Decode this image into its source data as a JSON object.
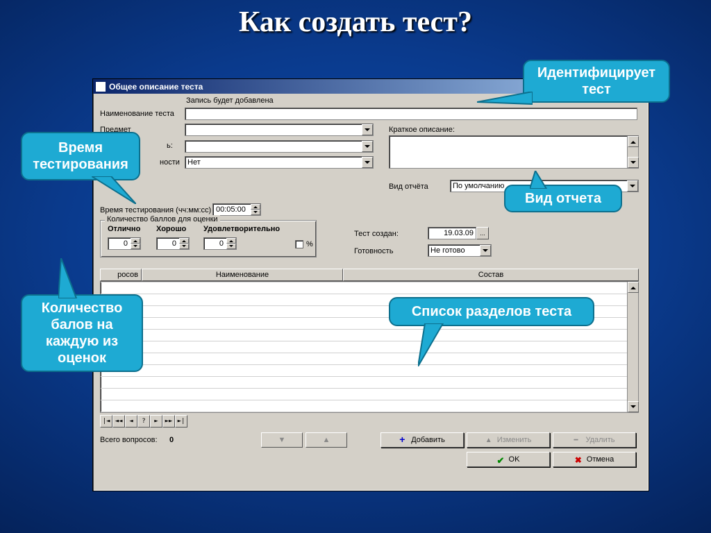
{
  "slide": {
    "title": "Как создать тест?"
  },
  "window": {
    "title": "Общее описание теста",
    "status_msg": "Запись будет добавлена",
    "labels": {
      "name": "Наименование теста",
      "subject": "Предмет",
      "difficulty_partial": "ности",
      "short_desc": "Краткое описание:",
      "report_type": "Вид отчёта",
      "time": "Время тестирования (чч:мм:сс)",
      "grades_group": "Количество баллов для оценки",
      "excellent": "Отлично",
      "good": "Хорошо",
      "satisfactory": "Удовлетворительно",
      "percent": "%",
      "created": "Тест создан:",
      "readiness": "Готовность",
      "col_questions": "росов",
      "col_name": "Наименование",
      "col_content": "Состав",
      "total_q": "Всего вопросов:"
    },
    "values": {
      "difficulty": "Нет",
      "report_type": "По умолчанию",
      "time": "00:05:00",
      "excellent": "0",
      "good": "0",
      "satisfactory": "0",
      "created": "19.03.09",
      "readiness": "Не готово",
      "total": "0"
    },
    "buttons": {
      "add": "Добавить",
      "edit": "Изменить",
      "delete": "Удалить",
      "ok": "OK",
      "cancel": "Отмена"
    },
    "nav": [
      "|◄",
      "◄◄",
      "◄",
      "?",
      "►",
      "►►",
      "►|"
    ]
  },
  "callouts": {
    "identifies": "Идентифицирует тест",
    "time": "Время тестирования",
    "report": "Вид отчета",
    "points": "Количество балов на каждую из оценок",
    "sections": "Список разделов теста"
  }
}
